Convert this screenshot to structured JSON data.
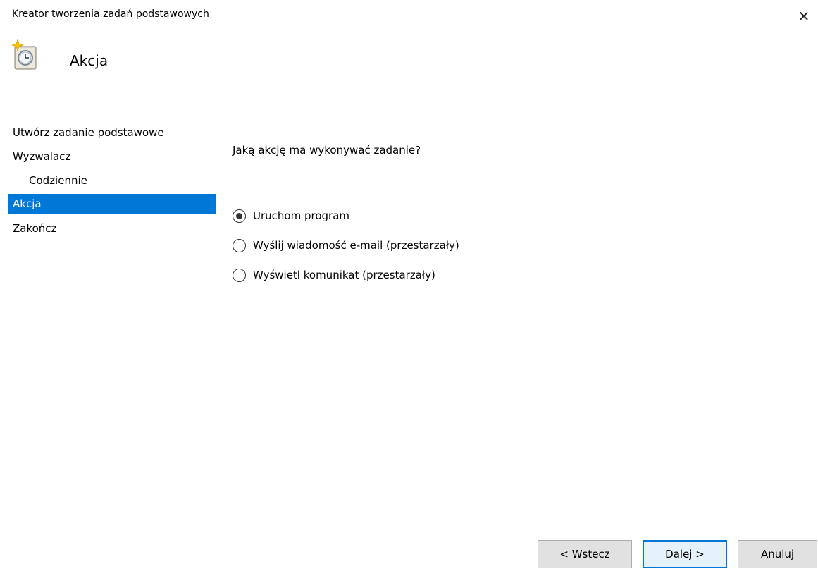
{
  "window": {
    "title": "Kreator tworzenia zadań podstawowych",
    "close_glyph": "✕"
  },
  "header": {
    "title": "Akcja",
    "icon": "task-scheduler-clock-icon"
  },
  "steps": [
    {
      "label": "Utwórz zadanie podstawowe",
      "selected": false,
      "indent": false
    },
    {
      "label": "Wyzwalacz",
      "selected": false,
      "indent": false
    },
    {
      "label": "Codziennie",
      "selected": false,
      "indent": true
    },
    {
      "label": "Akcja",
      "selected": true,
      "indent": false
    },
    {
      "label": "Zakończ",
      "selected": false,
      "indent": false
    }
  ],
  "content": {
    "question": "Jaką akcję ma wykonywać zadanie?",
    "options": [
      {
        "label": "Uruchom program",
        "checked": true
      },
      {
        "label": "Wyślij wiadomość e-mail (przestarzały)",
        "checked": false
      },
      {
        "label": "Wyświetl komunikat (przestarzały)",
        "checked": false
      }
    ]
  },
  "buttons": {
    "back": "< Wstecz",
    "next": "Dalej >",
    "cancel": "Anuluj"
  },
  "colors": {
    "selection": "#0078d7",
    "button_face": "#e1e1e1",
    "default_button_border": "#0078d7"
  }
}
